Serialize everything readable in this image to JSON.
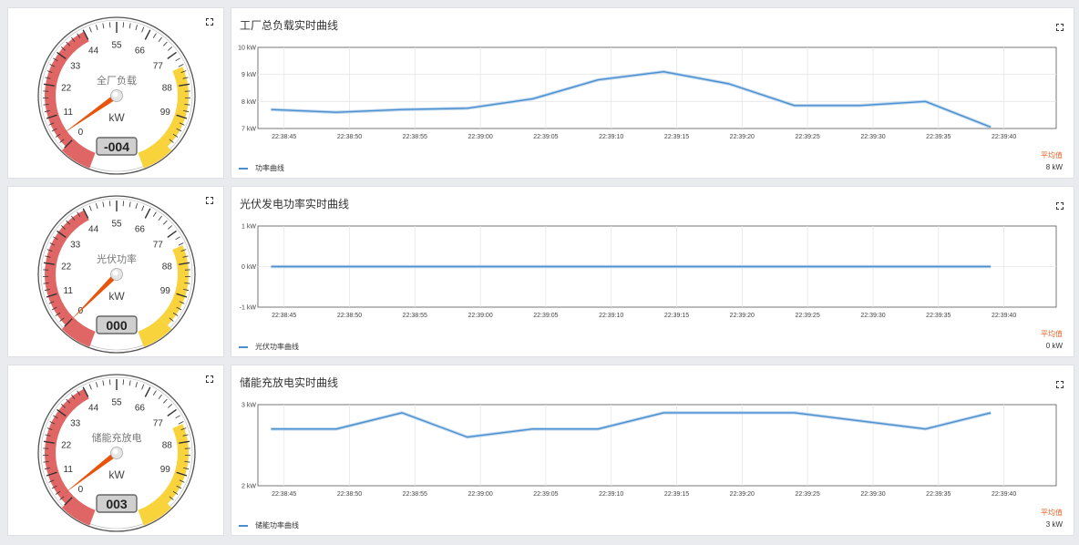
{
  "gauge_common": {
    "ticks": [
      "0",
      "11",
      "22",
      "33",
      "44",
      "55",
      "66",
      "77",
      "88",
      "99"
    ],
    "unit": "kW",
    "max": 110,
    "colors": {
      "red_zone": "#e06666",
      "yellow_zone": "#f9d33c",
      "needle": "#e8540c"
    }
  },
  "panels": [
    {
      "gauge": {
        "label": "全厂负载",
        "value": 4,
        "display": "-004"
      },
      "chart": {
        "title": "工厂总负载实时曲线",
        "legend": "功率曲线",
        "avg_label": "平均值",
        "avg_value": "8 kW"
      }
    },
    {
      "gauge": {
        "label": "光伏功率",
        "value": 0,
        "display": "000"
      },
      "chart": {
        "title": "光伏发电功率实时曲线",
        "legend": "光伏功率曲线",
        "avg_label": "平均值",
        "avg_value": "0 kW"
      }
    },
    {
      "gauge": {
        "label": "储能充放电",
        "value": 3,
        "display": "003"
      },
      "chart": {
        "title": "储能充放电实时曲线",
        "legend": "储能功率曲线",
        "avg_label": "平均值",
        "avg_value": "3 kW"
      }
    }
  ],
  "chart_data": [
    {
      "type": "line",
      "title": "工厂总负载实时曲线",
      "x_ticks": [
        "22:38:45",
        "22:38:50",
        "22:38:55",
        "22:39:00",
        "22:39:05",
        "22:39:10",
        "22:39:15",
        "22:39:20",
        "22:39:25",
        "22:39:30",
        "22:39:35",
        "22:39:40"
      ],
      "y_ticks": [
        "7 kW",
        "8 kW",
        "9 kW",
        "10 kW"
      ],
      "ylim": [
        7,
        10
      ],
      "xlim": [
        "22:38:43",
        "22:39:44"
      ],
      "grid": true,
      "color": "#4b8fce",
      "series": [
        {
          "name": "功率曲线",
          "x": [
            "22:38:44",
            "22:38:49",
            "22:38:54",
            "22:38:59",
            "22:39:04",
            "22:39:09",
            "22:39:14",
            "22:39:19",
            "22:39:24",
            "22:39:29",
            "22:39:34",
            "22:39:39"
          ],
          "values": [
            7.7,
            7.6,
            7.7,
            7.75,
            8.1,
            8.8,
            9.1,
            8.65,
            7.85,
            7.85,
            8.0,
            7.05
          ]
        }
      ]
    },
    {
      "type": "line",
      "title": "光伏发电功率实时曲线",
      "x_ticks": [
        "22:38:45",
        "22:38:50",
        "22:38:55",
        "22:39:00",
        "22:39:05",
        "22:39:10",
        "22:39:15",
        "22:39:20",
        "22:39:25",
        "22:39:30",
        "22:39:35",
        "22:39:40"
      ],
      "y_ticks": [
        "-1 kW",
        "0 kW",
        "1 kW"
      ],
      "ylim": [
        -1,
        1
      ],
      "xlim": [
        "22:38:43",
        "22:39:44"
      ],
      "grid": true,
      "color": "#4b8fce",
      "series": [
        {
          "name": "光伏功率曲线",
          "x": [
            "22:38:44",
            "22:38:49",
            "22:38:54",
            "22:38:59",
            "22:39:04",
            "22:39:09",
            "22:39:14",
            "22:39:19",
            "22:39:24",
            "22:39:29",
            "22:39:34",
            "22:39:39"
          ],
          "values": [
            0,
            0,
            0,
            0,
            0,
            0,
            0,
            0,
            0,
            0,
            0,
            0
          ]
        }
      ]
    },
    {
      "type": "line",
      "title": "储能充放电实时曲线",
      "x_ticks": [
        "22:38:45",
        "22:38:50",
        "22:38:55",
        "22:39:00",
        "22:39:05",
        "22:39:10",
        "22:39:15",
        "22:39:20",
        "22:39:25",
        "22:39:30",
        "22:39:35",
        "22:39:40"
      ],
      "y_ticks": [
        "2 kW",
        "3 kW"
      ],
      "ylim": [
        2,
        3
      ],
      "xlim": [
        "22:38:43",
        "22:39:44"
      ],
      "grid": true,
      "color": "#4b8fce",
      "series": [
        {
          "name": "储能功率曲线",
          "x": [
            "22:38:44",
            "22:38:49",
            "22:38:54",
            "22:38:59",
            "22:39:04",
            "22:39:09",
            "22:39:14",
            "22:39:19",
            "22:39:24",
            "22:39:29",
            "22:39:34",
            "22:39:39"
          ],
          "values": [
            2.7,
            2.7,
            2.9,
            2.6,
            2.7,
            2.7,
            2.9,
            2.9,
            2.9,
            2.8,
            2.7,
            2.9
          ]
        }
      ]
    }
  ]
}
